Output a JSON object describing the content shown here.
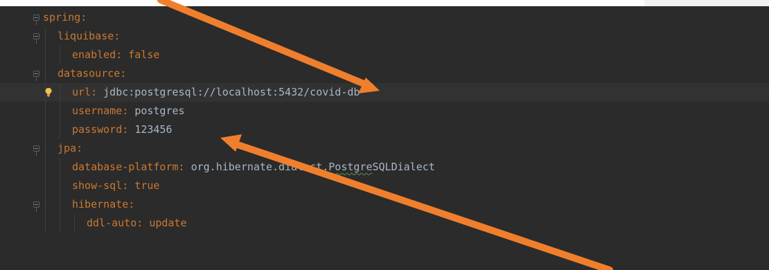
{
  "editor": {
    "lines": [
      {
        "indent": 0,
        "key": "spring",
        "sep": ":",
        "value": "",
        "type": "none"
      },
      {
        "indent": 1,
        "key": "liquibase",
        "sep": ":",
        "value": "",
        "type": "none"
      },
      {
        "indent": 2,
        "key": "enabled",
        "sep": ": ",
        "value": "false",
        "type": "kw"
      },
      {
        "indent": 1,
        "key": "datasource",
        "sep": ":",
        "value": "",
        "type": "none"
      },
      {
        "indent": 2,
        "key": "url",
        "sep": ": ",
        "value": "jdbc:postgresql://localhost:5432/covid-db",
        "type": "str"
      },
      {
        "indent": 2,
        "key": "username",
        "sep": ": ",
        "value": "postgres",
        "type": "str"
      },
      {
        "indent": 2,
        "key": "password",
        "sep": ": ",
        "value": "123456",
        "type": "num"
      },
      {
        "indent": 1,
        "key": "jpa",
        "sep": ":",
        "value": "",
        "type": "none"
      },
      {
        "indent": 2,
        "key": "database-platform",
        "sep": ": ",
        "value": "org.hibernate.dialect.PostgreSQLDialect",
        "type": "str"
      },
      {
        "indent": 2,
        "key": "show-sql",
        "sep": ": ",
        "value": "true",
        "type": "kw"
      },
      {
        "indent": 2,
        "key": "hibernate",
        "sep": ":",
        "value": "",
        "type": "none"
      },
      {
        "indent": 3,
        "key": "ddl-auto",
        "sep": ": ",
        "value": "update",
        "type": "kw"
      }
    ],
    "current_line_index": 4,
    "intention_icon": "lightbulb-icon"
  },
  "annotations": {
    "arrow_color": "#f07f2d",
    "arrows": [
      "annotation-arrow-to-url",
      "annotation-arrow-to-username"
    ]
  },
  "colors": {
    "background": "#2b2b2b",
    "current_line": "#323232",
    "key": "#cc7832",
    "text": "#a9b7c6"
  }
}
